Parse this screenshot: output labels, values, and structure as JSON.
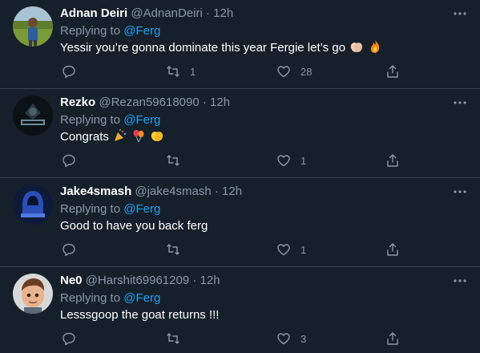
{
  "tweets": [
    {
      "name": "Adnan Deiri",
      "handle": "@AdnanDeiri",
      "time": "12h",
      "replying_prefix": "Replying to",
      "replying_to": "@Ferg",
      "text": "Yessir you’re gonna dominate this year Fergie let’s go",
      "text_emojis": [
        "clapping-hands",
        "fire"
      ],
      "replies": "",
      "retweets": "1",
      "likes": "28",
      "avatar": "photo of person in green field"
    },
    {
      "name": "Rezko",
      "handle": "@Rezan59618090",
      "time": "12h",
      "replying_prefix": "Replying to",
      "replying_to": "@Ferg",
      "text": "Congrats",
      "text_emojis": [
        "party-popper",
        "balloons",
        "clapping-hands"
      ],
      "replies": "",
      "retweets": "",
      "likes": "1",
      "avatar": "dark gaming logo"
    },
    {
      "name": "Jake4smash",
      "handle": "@jake4smash",
      "time": "12h",
      "replying_prefix": "Replying to",
      "replying_to": "@Ferg",
      "text": "Good to have you back ferg",
      "text_emojis": [],
      "replies": "",
      "retweets": "",
      "likes": "1",
      "avatar": "blue hooded figure logo"
    },
    {
      "name": "Ne0",
      "handle": "@Harshit69961209",
      "time": "12h",
      "replying_prefix": "Replying to",
      "replying_to": "@Ferg",
      "text": "Lesssgoop the goat returns !!!",
      "text_emojis": [],
      "replies": "",
      "retweets": "",
      "likes": "3",
      "avatar": "memoji boy"
    }
  ],
  "separator": "·",
  "colors": {
    "background": "#15202b",
    "divider": "#38444d",
    "accent": "#1da1f2",
    "muted": "#8b98a5",
    "text": "#ffffff"
  }
}
